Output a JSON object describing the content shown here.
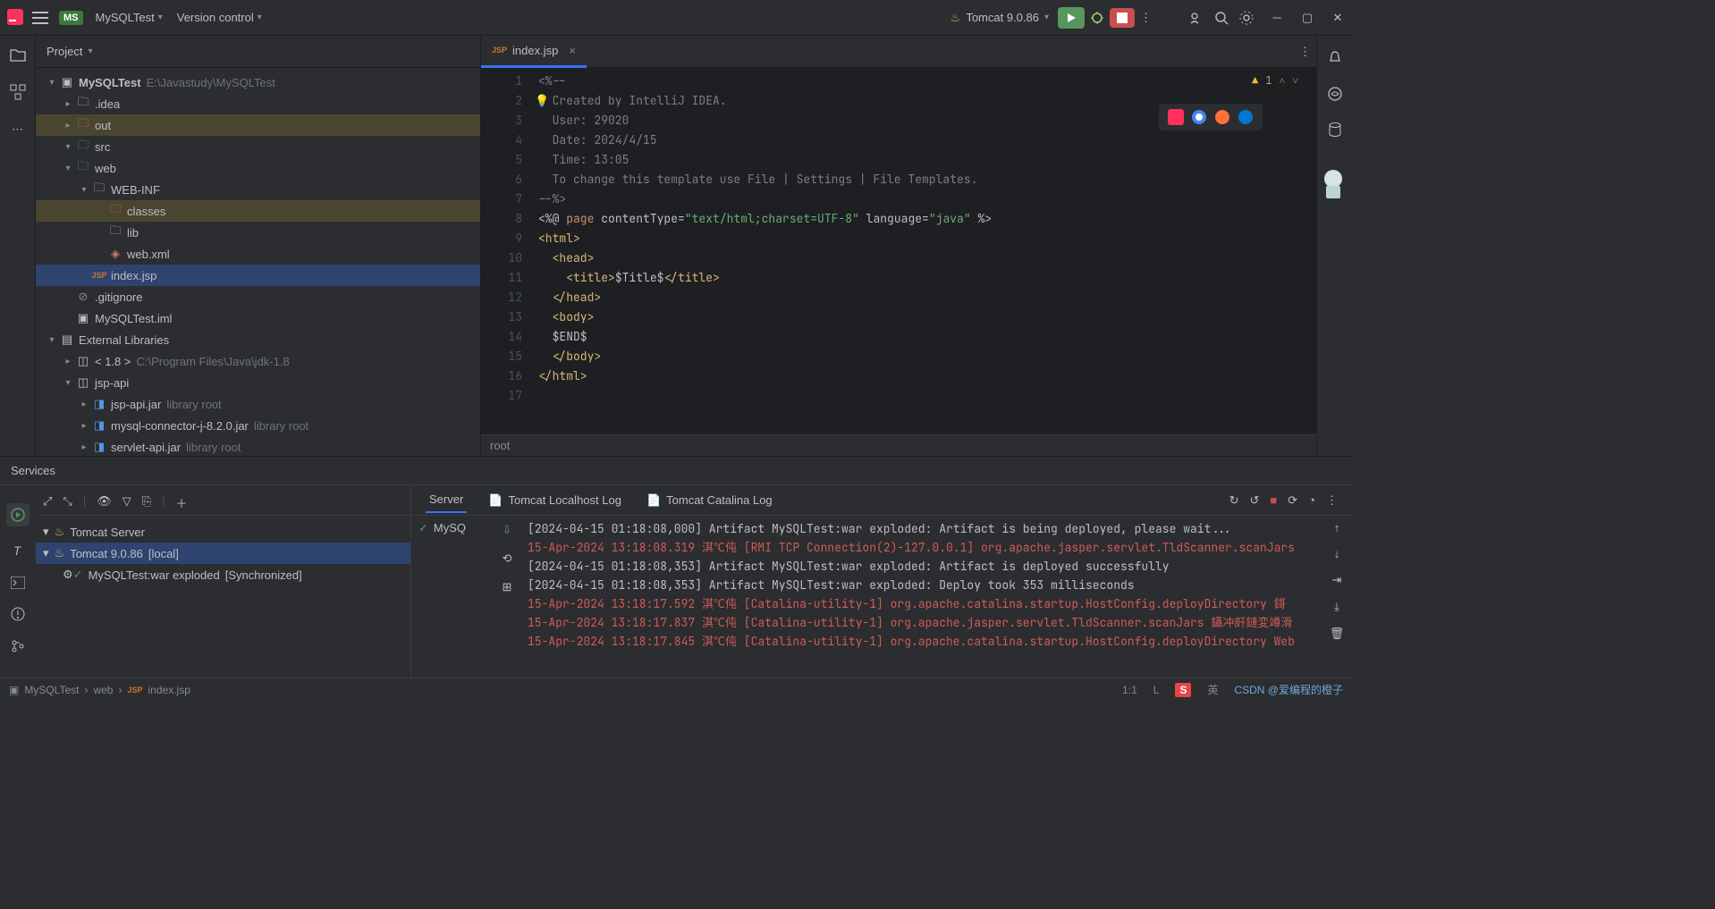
{
  "titleBar": {
    "projectBadge": "MS",
    "projectName": "MySQLTest",
    "versionControl": "Version control",
    "runConfig": "Tomcat 9.0.86"
  },
  "projectPanel": {
    "title": "Project",
    "tree": {
      "root": {
        "name": "MySQLTest",
        "path": "E:\\Javastudy\\MySQLTest"
      },
      "idea": ".idea",
      "out": "out",
      "src": "src",
      "web": "web",
      "webinf": "WEB-INF",
      "classes": "classes",
      "lib": "lib",
      "webxml": "web.xml",
      "indexjsp": "index.jsp",
      "gitignore": ".gitignore",
      "iml": "MySQLTest.iml",
      "extlib": "External Libraries",
      "jdk": {
        "name": "< 1.8 >",
        "path": "C:\\Program Files\\Java\\jdk-1.8"
      },
      "jspapi": "jsp-api",
      "jspApiJar": {
        "name": "jsp-api.jar",
        "note": "library root"
      },
      "mysqlJar": {
        "name": "mysql-connector-j-8.2.0.jar",
        "note": "library root"
      },
      "servletJar": {
        "name": "servlet-api.jar",
        "note": "library root"
      }
    }
  },
  "editor": {
    "tab": {
      "icon": "JSP",
      "name": "index.jsp"
    },
    "warnCount": "1",
    "footer": "root",
    "lines": [
      "<%--",
      "  Created by IntelliJ IDEA.",
      "  User: 29020",
      "  Date: 2024/4/15",
      "  Time: 13:05",
      "  To change this template use File | Settings | File Templates.",
      "--%>",
      "<%@ page contentType=\"text/html;charset=UTF-8\" language=\"java\" %>",
      "<html>",
      "  <head>",
      "    <title>$Title$</title>",
      "  </head>",
      "  <body>",
      "  $END$",
      "  </body>",
      "</html>",
      ""
    ]
  },
  "services": {
    "title": "Services",
    "tree": {
      "tomcatServer": "Tomcat Server",
      "tomcat": {
        "name": "Tomcat 9.0.86",
        "note": "[local]"
      },
      "artifact": {
        "name": "MySQLTest:war exploded",
        "note": "[Synchronized]"
      }
    },
    "tabs": {
      "server": "Server",
      "localhost": "Tomcat Localhost Log",
      "catalina": "Tomcat Catalina Log"
    },
    "statusLabel": "MySQ",
    "log": [
      {
        "err": false,
        "text": "[2024-04-15 01:18:08,000] Artifact MySQLTest:war exploded: Artifact is being deployed, please wait..."
      },
      {
        "err": true,
        "text": "15-Apr-2024 13:18:08.319 淇℃伅 [RMI TCP Connection(2)-127.0.0.1] org.apache.jasper.servlet.TldScanner.scanJars"
      },
      {
        "err": false,
        "text": "[2024-04-15 01:18:08,353] Artifact MySQLTest:war exploded: Artifact is deployed successfully"
      },
      {
        "err": false,
        "text": "[2024-04-15 01:18:08,353] Artifact MySQLTest:war exploded: Deploy took 353 milliseconds"
      },
      {
        "err": true,
        "text": "15-Apr-2024 13:18:17.592 淇℃伅 [Catalina-utility-1] org.apache.catalina.startup.HostConfig.deployDirectory 鎶"
      },
      {
        "err": true,
        "text": "15-Apr-2024 13:18:17.837 淇℃伅 [Catalina-utility-1] org.apache.jasper.servlet.TldScanner.scanJars 鑷冲皯鏈変竴滑"
      },
      {
        "err": true,
        "text": "15-Apr-2024 13:18:17.845 淇℃伅 [Catalina-utility-1] org.apache.catalina.startup.HostConfig.deployDirectory Web"
      }
    ]
  },
  "statusBar": {
    "crumbs": [
      "MySQLTest",
      "web",
      "index.jsp"
    ],
    "pos": "1:1",
    "encoding": "L",
    "ime": "英",
    "watermark": "CSDN @爱编程的橙子"
  }
}
